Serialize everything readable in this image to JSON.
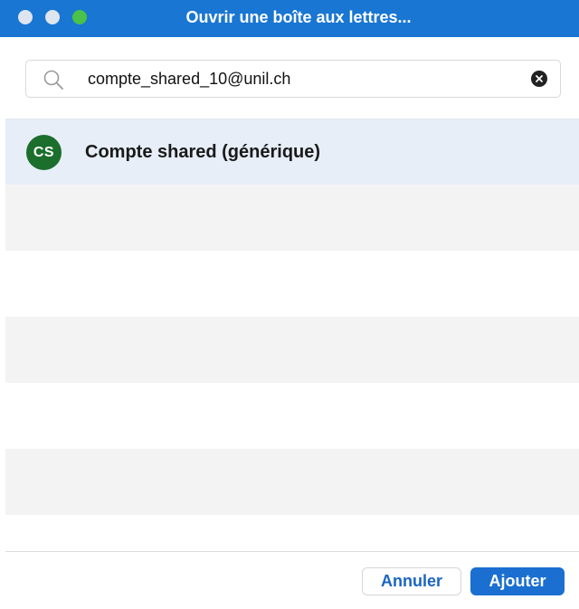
{
  "window": {
    "title": "Ouvrir une boîte aux lettres..."
  },
  "search": {
    "value": "compte_shared_10@unil.ch",
    "placeholder": ""
  },
  "results": [
    {
      "initials": "CS",
      "label": "Compte shared (générique)",
      "avatar_color": "#1b6e2c",
      "selected": true
    }
  ],
  "footer": {
    "cancel_label": "Annuler",
    "confirm_label": "Ajouter"
  },
  "colors": {
    "titlebar": "#1976d2",
    "selection": "#e7eef8",
    "accent": "#1a6fd1"
  }
}
